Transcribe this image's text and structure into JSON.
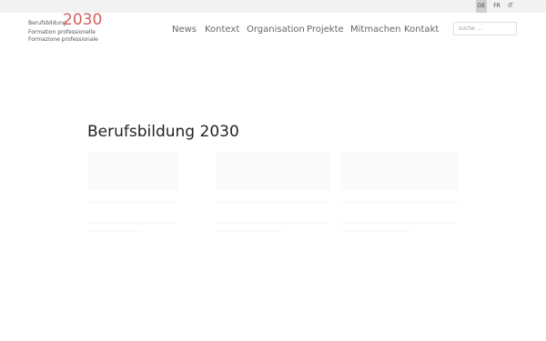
{
  "languages": [
    {
      "code": "DE",
      "active": true
    },
    {
      "code": "FR",
      "active": false
    },
    {
      "code": "IT",
      "active": false
    }
  ],
  "logo": {
    "line1": "Berufsbildung",
    "year": "2030",
    "line2": "Formation professionelle",
    "line3": "Formazione professionale",
    "year_color": "#d45f5f"
  },
  "nav": {
    "items": [
      "News",
      "Kontext",
      "Organisation",
      "Projekte",
      "Mitmachen",
      "Kontakt"
    ]
  },
  "search": {
    "placeholder": "suche ..."
  },
  "main": {
    "title": "Berufsbildung 2030"
  }
}
